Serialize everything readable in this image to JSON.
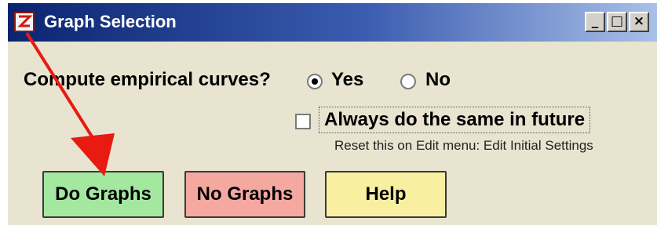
{
  "window": {
    "title": "Graph Selection",
    "controls": {
      "minimize": "_",
      "maximize": "□",
      "close": "×"
    }
  },
  "question": {
    "text": "Compute empirical curves?",
    "options": [
      {
        "label": "Yes",
        "selected": true
      },
      {
        "label": "No",
        "selected": false
      }
    ]
  },
  "checkbox": {
    "label": "Always do the same in future",
    "checked": false,
    "hint": "Reset this on Edit menu: Edit Initial Settings"
  },
  "buttons": {
    "do_graphs": "Do Graphs",
    "no_graphs": "No Graphs",
    "help": "Help"
  },
  "colors": {
    "do_graphs_bg": "#a4e8a0",
    "no_graphs_bg": "#f4a8a0",
    "help_bg": "#f8f0a0",
    "arrow": "#e81a12",
    "titlebar_start": "#0a2470"
  },
  "icons": {
    "app": "app-icon",
    "annotation": "red-arrow"
  }
}
